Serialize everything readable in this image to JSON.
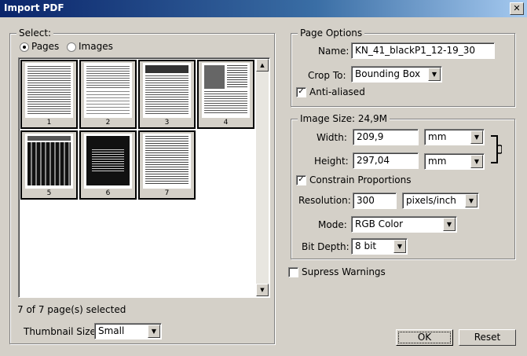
{
  "window": {
    "title": "Import PDF",
    "close": "✕"
  },
  "select": {
    "title": "Select:",
    "pages_label": "Pages",
    "images_label": "Images",
    "thumbnails": [
      "1",
      "2",
      "3",
      "4",
      "5",
      "6",
      "7"
    ],
    "status": "7 of 7 page(s) selected",
    "thumbnail_size_label": "Thumbnail Size:",
    "thumbnail_size_value": "Small"
  },
  "page_options": {
    "title": "Page Options",
    "name_label": "Name:",
    "name_value": "KN_41_blackP1_12-19_30",
    "crop_label": "Crop To:",
    "crop_value": "Bounding Box",
    "antialias_label": "Anti-aliased"
  },
  "image_size": {
    "title": "Image Size: 24,9M",
    "width_label": "Width:",
    "width_value": "209,9",
    "width_unit": "mm",
    "height_label": "Height:",
    "height_value": "297,04",
    "height_unit": "mm",
    "constrain_label": "Constrain Proportions",
    "resolution_label": "Resolution:",
    "resolution_value": "300",
    "resolution_unit": "pixels/inch",
    "mode_label": "Mode:",
    "mode_value": "RGB Color",
    "bitdepth_label": "Bit Depth:",
    "bitdepth_value": "8 bit"
  },
  "suppress_label": "Supress Warnings",
  "buttons": {
    "ok": "OK",
    "reset": "Reset"
  },
  "icons": {
    "radio_selected": "radio-dot",
    "check": "✓",
    "arrow": "▼",
    "up": "▲",
    "down": "▼"
  }
}
